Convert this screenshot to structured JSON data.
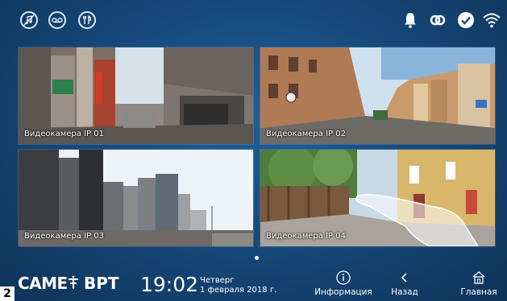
{
  "topbar": {
    "left_icons": [
      "music-off-icon",
      "voicemail-icon",
      "restaurant-icon"
    ],
    "right_icons": [
      "bell-icon",
      "link-icon",
      "check-circle-icon",
      "wifi-icon"
    ]
  },
  "cameras": [
    {
      "label": "Видеокамера IP 01"
    },
    {
      "label": "Видеокамера IP 02"
    },
    {
      "label": "Видеокамера IP 03"
    },
    {
      "label": "Видеокамера IP 04"
    }
  ],
  "pager": {
    "current_page": 1
  },
  "footer": {
    "brand_left": "CAME",
    "brand_right": "BPT",
    "time": "19:02",
    "weekday": "Четверг",
    "date": "1 февраля 2018 г.",
    "nav": {
      "info": "Информация",
      "back": "Назад",
      "home": "Главная"
    }
  },
  "step_badge": "2",
  "colors": {
    "background": "#164a7c",
    "text": "#ffffff"
  }
}
